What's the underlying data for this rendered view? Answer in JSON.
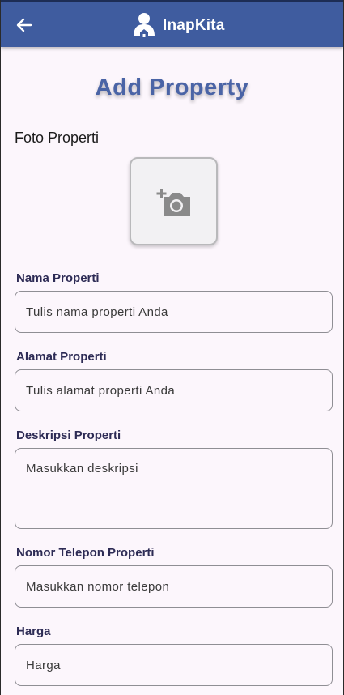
{
  "appbar": {
    "title": "InapKita",
    "icons": {
      "back": "arrow-left-icon",
      "logo": "house-person-logo-icon"
    },
    "color": "#3f5c9f"
  },
  "page": {
    "title": "Add Property"
  },
  "photo": {
    "label": "Foto Properti",
    "icon": "add-photo-camera-icon"
  },
  "form": {
    "fields": [
      {
        "label": "Nama Properti",
        "placeholder": "Tulis nama properti Anda"
      },
      {
        "label": "Alamat Properti",
        "placeholder": "Tulis alamat properti Anda"
      },
      {
        "label": "Deskripsi Properti",
        "placeholder": "Masukkan deskripsi"
      },
      {
        "label": "Nomor Telepon Properti",
        "placeholder": "Masukkan nomor telepon"
      },
      {
        "label": "Harga",
        "placeholder": "Harga"
      }
    ]
  }
}
